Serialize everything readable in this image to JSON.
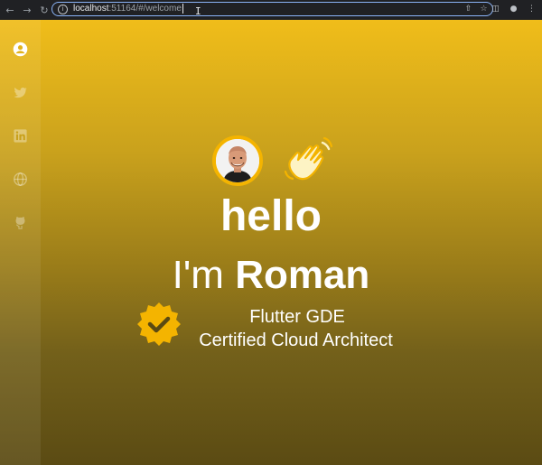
{
  "browser": {
    "url_host": "localhost",
    "url_path": ":51164/#/welcome",
    "back_icon": "arrow-left-icon",
    "forward_icon": "arrow-right-icon",
    "reload_icon": "reload-icon"
  },
  "sidebar": {
    "items": [
      {
        "icon": "account-icon"
      },
      {
        "icon": "twitter-icon"
      },
      {
        "icon": "linkedin-icon"
      },
      {
        "icon": "globe-icon"
      },
      {
        "icon": "github-icon"
      }
    ]
  },
  "hero": {
    "greeting": "hello",
    "intro_prefix": "I'm ",
    "name": "Roman",
    "title_line1": "Flutter GDE",
    "title_line2": "Certified Cloud Architect"
  },
  "colors": {
    "gradient_top": "#f0bd1a",
    "gradient_bottom": "#5b4b13",
    "accent": "#f4b400",
    "text": "#ffffff"
  }
}
